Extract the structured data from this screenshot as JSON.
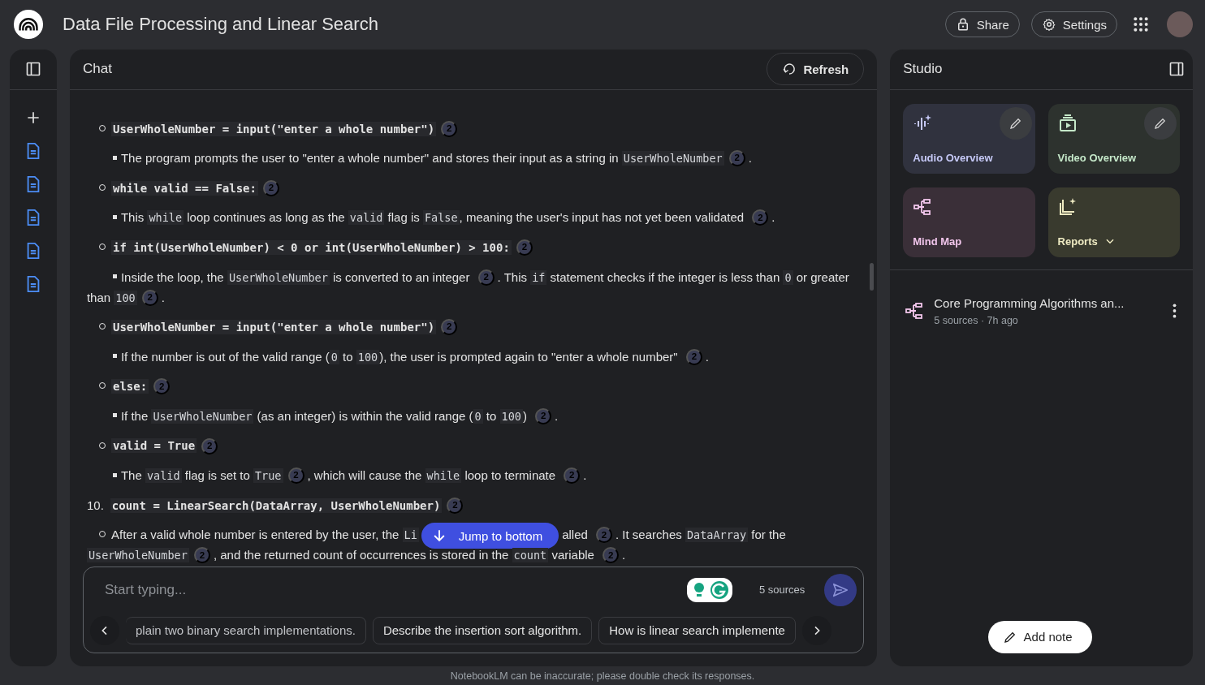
{
  "app": {
    "title": "Data File Processing and Linear Search",
    "buttons": [
      {
        "kind": "share",
        "label": "Share"
      },
      {
        "kind": "settings",
        "label": "Settings"
      }
    ]
  },
  "chat": {
    "title": "Chat",
    "refresh": "Refresh",
    "jump": "Jump to bottom",
    "lines": [
      {
        "kind": "circle",
        "parts": [
          {
            "kind": "strong_code",
            "text": "UserWholeNumber = input(\"enter a whole number\")"
          },
          {
            "kind": "cite",
            "text": "2"
          }
        ]
      },
      {
        "kind": "square",
        "parts": [
          {
            "kind": "text",
            "text": "The program prompts the user to \"enter a whole number\" and stores their input as a string in "
          },
          {
            "kind": "code",
            "text": "UserWholeNumber"
          },
          {
            "kind": "cite",
            "text": "2"
          },
          {
            "kind": "text",
            "text": "."
          }
        ]
      },
      {
        "kind": "circle",
        "parts": [
          {
            "kind": "strong_code",
            "text": "while valid == False:"
          },
          {
            "kind": "cite",
            "text": "2"
          }
        ]
      },
      {
        "kind": "square",
        "parts": [
          {
            "kind": "text",
            "text": "This "
          },
          {
            "kind": "code",
            "text": "while"
          },
          {
            "kind": "text",
            "text": " loop continues as long as the "
          },
          {
            "kind": "code",
            "text": "valid"
          },
          {
            "kind": "text",
            "text": " flag is "
          },
          {
            "kind": "code",
            "text": "False"
          },
          {
            "kind": "text",
            "text": ", meaning the user's input has not yet been validated "
          },
          {
            "kind": "cite",
            "text": "2"
          },
          {
            "kind": "text",
            "text": "."
          }
        ]
      },
      {
        "kind": "circle",
        "parts": [
          {
            "kind": "strong_code",
            "text": "if int(UserWholeNumber) < 0 or int(UserWholeNumber) > 100:"
          },
          {
            "kind": "cite",
            "text": "2"
          }
        ]
      },
      {
        "kind": "square",
        "parts": [
          {
            "kind": "text",
            "text": "Inside the loop, the "
          },
          {
            "kind": "code",
            "text": "UserWholeNumber"
          },
          {
            "kind": "text",
            "text": " is converted to an integer "
          },
          {
            "kind": "cite",
            "text": "2"
          },
          {
            "kind": "text",
            "text": ". This "
          },
          {
            "kind": "code",
            "text": "if"
          },
          {
            "kind": "text",
            "text": " statement checks if the integer is less than "
          },
          {
            "kind": "code",
            "text": "0"
          },
          {
            "kind": "text",
            "text": " or greater than "
          },
          {
            "kind": "code",
            "text": "100"
          },
          {
            "kind": "cite",
            "text": "2"
          },
          {
            "kind": "text",
            "text": "."
          }
        ]
      },
      {
        "kind": "circle",
        "parts": [
          {
            "kind": "strong_code",
            "text": "UserWholeNumber = input(\"enter a whole number\")"
          },
          {
            "kind": "cite",
            "text": "2"
          }
        ]
      },
      {
        "kind": "square",
        "parts": [
          {
            "kind": "text",
            "text": "If the number is out of the valid range ("
          },
          {
            "kind": "code",
            "text": "0"
          },
          {
            "kind": "text",
            "text": " to "
          },
          {
            "kind": "code",
            "text": "100"
          },
          {
            "kind": "text",
            "text": "), the user is prompted again to \"enter a whole number\" "
          },
          {
            "kind": "cite",
            "text": "2"
          },
          {
            "kind": "text",
            "text": "."
          }
        ]
      },
      {
        "kind": "circle",
        "parts": [
          {
            "kind": "strong_code",
            "text": "else:"
          },
          {
            "kind": "cite",
            "text": "2"
          }
        ]
      },
      {
        "kind": "square",
        "parts": [
          {
            "kind": "text",
            "text": "If the "
          },
          {
            "kind": "code",
            "text": "UserWholeNumber"
          },
          {
            "kind": "text",
            "text": " (as an integer) is within the valid range ("
          },
          {
            "kind": "code",
            "text": "0"
          },
          {
            "kind": "text",
            "text": " to "
          },
          {
            "kind": "code",
            "text": "100"
          },
          {
            "kind": "text",
            "text": ") "
          },
          {
            "kind": "cite",
            "text": "2"
          },
          {
            "kind": "text",
            "text": "."
          }
        ]
      },
      {
        "kind": "circle",
        "parts": [
          {
            "kind": "strong_code",
            "text": "valid = True"
          },
          {
            "kind": "cite",
            "text": "2"
          }
        ]
      },
      {
        "kind": "square",
        "parts": [
          {
            "kind": "text",
            "text": "The "
          },
          {
            "kind": "code",
            "text": "valid"
          },
          {
            "kind": "text",
            "text": " flag is set to "
          },
          {
            "kind": "code",
            "text": "True"
          },
          {
            "kind": "cite",
            "text": "2"
          },
          {
            "kind": "text",
            "text": ", which will cause the "
          },
          {
            "kind": "code",
            "text": "while"
          },
          {
            "kind": "text",
            "text": " loop to terminate "
          },
          {
            "kind": "cite",
            "text": "2"
          },
          {
            "kind": "text",
            "text": "."
          }
        ]
      },
      {
        "kind": "numbered",
        "marker": "10.",
        "parts": [
          {
            "kind": "strong_code",
            "text": "count = LinearSearch(DataArray, UserWholeNumber)"
          },
          {
            "kind": "cite",
            "text": "2"
          }
        ]
      },
      {
        "kind": "circle",
        "parts": [
          {
            "kind": "text",
            "text": "After a valid whole number is entered by the user, the "
          },
          {
            "kind": "code",
            "text": "Li"
          },
          {
            "kind": "jump"
          },
          {
            "kind": "text",
            "text": "alled "
          },
          {
            "kind": "cite",
            "text": "2"
          },
          {
            "kind": "text",
            "text": ". It searches "
          },
          {
            "kind": "code",
            "text": "DataArray"
          },
          {
            "kind": "text",
            "text": " for the "
          },
          {
            "kind": "code",
            "text": "UserWholeNumber"
          },
          {
            "kind": "cite",
            "text": "2"
          },
          {
            "kind": "text",
            "text": ", and the returned count of occurrences is stored in the "
          },
          {
            "kind": "code",
            "text": "count"
          },
          {
            "kind": "text",
            "text": " variable "
          },
          {
            "kind": "cite",
            "text": "2"
          },
          {
            "kind": "text",
            "text": "."
          }
        ]
      }
    ],
    "composer": {
      "placeholder": "Start typing...",
      "sources": "5 sources"
    },
    "suggestions": [
      "plain two binary search implementations.",
      "Describe the insertion sort algorithm.",
      "How is linear search implemente"
    ]
  },
  "studio": {
    "title": "Studio",
    "tiles": [
      {
        "kind": "audio",
        "label": "Audio Overview",
        "color": "#30323e",
        "editable": true,
        "menu": false
      },
      {
        "kind": "video",
        "label": "Video Overview",
        "color": "#2d322e",
        "editable": true,
        "menu": false
      },
      {
        "kind": "mindmap",
        "label": "Mind Map",
        "color": "#3a2f38",
        "editable": false,
        "menu": false
      },
      {
        "kind": "reports",
        "label": "Reports",
        "color": "#393a2e",
        "editable": false,
        "menu": true
      }
    ],
    "notes": [
      {
        "title": "Core Programming Algorithms an...",
        "meta": "5 sources · 7h ago"
      }
    ],
    "add_note": "Add note"
  },
  "footer": "NotebookLM can be inaccurate; please double check its responses."
}
